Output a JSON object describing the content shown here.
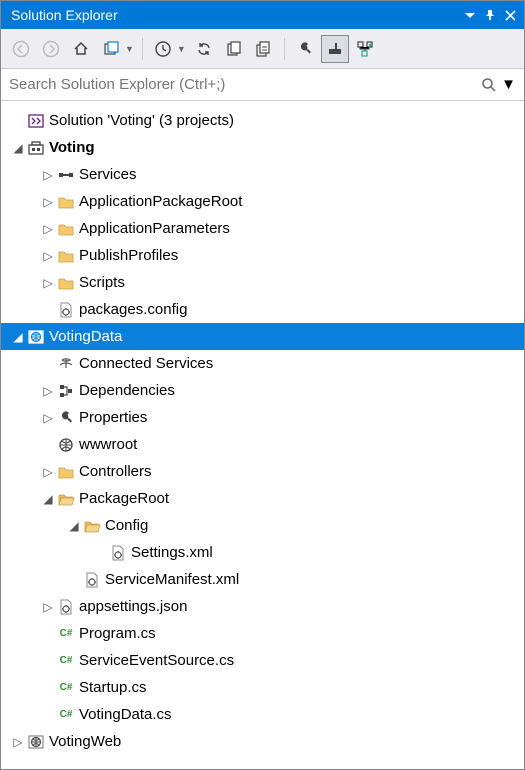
{
  "title": "Solution Explorer",
  "search": {
    "placeholder": "Search Solution Explorer (Ctrl+;)"
  },
  "tree": {
    "solution": "Solution 'Voting' (3 projects)",
    "voting": {
      "name": "Voting",
      "services": "Services",
      "appPkgRoot": "ApplicationPackageRoot",
      "appParams": "ApplicationParameters",
      "publishProfiles": "PublishProfiles",
      "scripts": "Scripts",
      "packagesConfig": "packages.config"
    },
    "votingData": {
      "name": "VotingData",
      "connectedServices": "Connected Services",
      "dependencies": "Dependencies",
      "properties": "Properties",
      "wwwroot": "wwwroot",
      "controllers": "Controllers",
      "packageRoot": "PackageRoot",
      "config": "Config",
      "settingsXml": "Settings.xml",
      "serviceManifest": "ServiceManifest.xml",
      "appsettings": "appsettings.json",
      "program": "Program.cs",
      "serviceEventSource": "ServiceEventSource.cs",
      "startup": "Startup.cs",
      "votingDataCs": "VotingData.cs"
    },
    "votingWeb": {
      "name": "VotingWeb"
    }
  }
}
